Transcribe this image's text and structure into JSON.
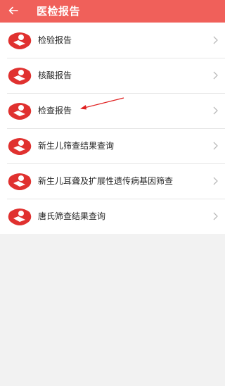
{
  "header": {
    "back_icon": "arrow-left-icon",
    "title": "医检报告",
    "bg_color": "#f0605a"
  },
  "items": [
    {
      "label": "检验报告",
      "icon": "hospital-logo-icon"
    },
    {
      "label": "核酸报告",
      "icon": "hospital-logo-icon"
    },
    {
      "label": "检查报告",
      "icon": "hospital-logo-icon"
    },
    {
      "label": "新生儿筛查结果查询",
      "icon": "hospital-logo-icon"
    },
    {
      "label": "新生儿耳聋及扩展性遗传病基因筛查",
      "icon": "hospital-logo-icon"
    },
    {
      "label": "唐氏筛查结果查询",
      "icon": "hospital-logo-icon"
    }
  ],
  "chevron_icon": "chevron-right-icon",
  "annotation_icon": "red-arrow-icon",
  "colors": {
    "brand_red": "#e0312f",
    "annotation_red": "#e02020"
  }
}
